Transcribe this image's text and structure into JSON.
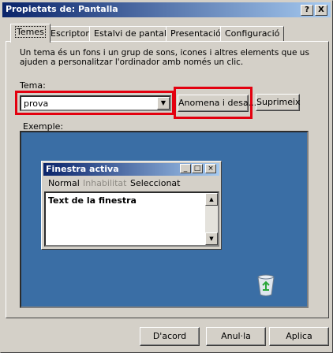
{
  "window": {
    "title": "Propietats de: Pantalla",
    "help_btn": "?",
    "close_btn": "X"
  },
  "tabs": [
    {
      "label": "Temes",
      "active": true
    },
    {
      "label": "Escriptori"
    },
    {
      "label": "Estalvi de pantalla"
    },
    {
      "label": "Presentació"
    },
    {
      "label": "Configuració"
    }
  ],
  "content": {
    "description": "Un tema és un fons i un grup de sons, icones i altres elements que us ajuden a personalitzar l'ordinador amb només un clic.",
    "theme_label": "Tema:",
    "theme_value": "prova",
    "save_as_btn": "Anomena i desa...",
    "delete_btn": "Suprimeix",
    "example_label": "Exemple:"
  },
  "preview": {
    "window_title": "Finestra activa",
    "menu_normal": "Normal",
    "menu_disabled": "Inhabilitat",
    "menu_selected": "Seleccionat",
    "text": "Text de la finestra"
  },
  "footer": {
    "ok": "D'acord",
    "cancel": "Anul·la",
    "apply": "Aplica"
  },
  "colors": {
    "titlebar_start": "#0a246a",
    "titlebar_end": "#a6caf0",
    "desktop": "#3a6ea5",
    "highlight": "#e3000f"
  },
  "icons": [
    "help-icon",
    "close-icon",
    "chevron-down-icon",
    "recycle-bin-icon"
  ]
}
